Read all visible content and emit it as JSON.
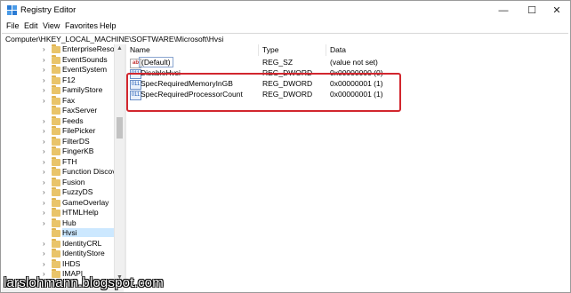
{
  "window": {
    "title": "Registry Editor",
    "controls": {
      "minimize": "—",
      "maximize": "☐",
      "close": "✕"
    }
  },
  "menu": [
    "File",
    "Edit",
    "View",
    "Favorites",
    "Help"
  ],
  "address": "Computer\\HKEY_LOCAL_MACHINE\\SOFTWARE\\Microsoft\\Hvsi",
  "tree": {
    "items": [
      {
        "label": "EnterpriseResourc",
        "selected": false
      },
      {
        "label": "EventSounds",
        "selected": false
      },
      {
        "label": "EventSystem",
        "selected": false
      },
      {
        "label": "F12",
        "selected": false
      },
      {
        "label": "FamilyStore",
        "selected": false
      },
      {
        "label": "Fax",
        "selected": false
      },
      {
        "label": "FaxServer",
        "selected": false
      },
      {
        "label": "Feeds",
        "selected": false
      },
      {
        "label": "FilePicker",
        "selected": false
      },
      {
        "label": "FilterDS",
        "selected": false
      },
      {
        "label": "FingerKB",
        "selected": false
      },
      {
        "label": "FTH",
        "selected": false
      },
      {
        "label": "Function Discove",
        "selected": false
      },
      {
        "label": "Fusion",
        "selected": false
      },
      {
        "label": "FuzzyDS",
        "selected": false
      },
      {
        "label": "GameOverlay",
        "selected": false
      },
      {
        "label": "HTMLHelp",
        "selected": false
      },
      {
        "label": "Hub",
        "selected": false
      },
      {
        "label": "Hvsi",
        "selected": true
      },
      {
        "label": "IdentityCRL",
        "selected": false
      },
      {
        "label": "IdentityStore",
        "selected": false
      },
      {
        "label": "IHDS",
        "selected": false
      },
      {
        "label": "IMAPI",
        "selected": false
      }
    ]
  },
  "list": {
    "columns": {
      "name": "Name",
      "type": "Type",
      "data": "Data"
    },
    "rows": [
      {
        "name": "(Default)",
        "type": "REG_SZ",
        "data": "(value not set)",
        "icon": "string-value-icon"
      },
      {
        "name": "DisableHvsi",
        "type": "REG_DWORD",
        "data": "0x00000000 (0)",
        "icon": "dword-value-icon"
      },
      {
        "name": "SpecRequiredMemoryInGB",
        "type": "REG_DWORD",
        "data": "0x00000001 (1)",
        "icon": "dword-value-icon"
      },
      {
        "name": "SpecRequiredProcessorCount",
        "type": "REG_DWORD",
        "data": "0x00000001 (1)",
        "icon": "dword-value-icon"
      }
    ]
  },
  "watermark": "larslohmann.blogspot.com",
  "colors": {
    "highlight_box": "#d2262e",
    "folder": "#e9c46a",
    "selection": "#cce8ff"
  }
}
